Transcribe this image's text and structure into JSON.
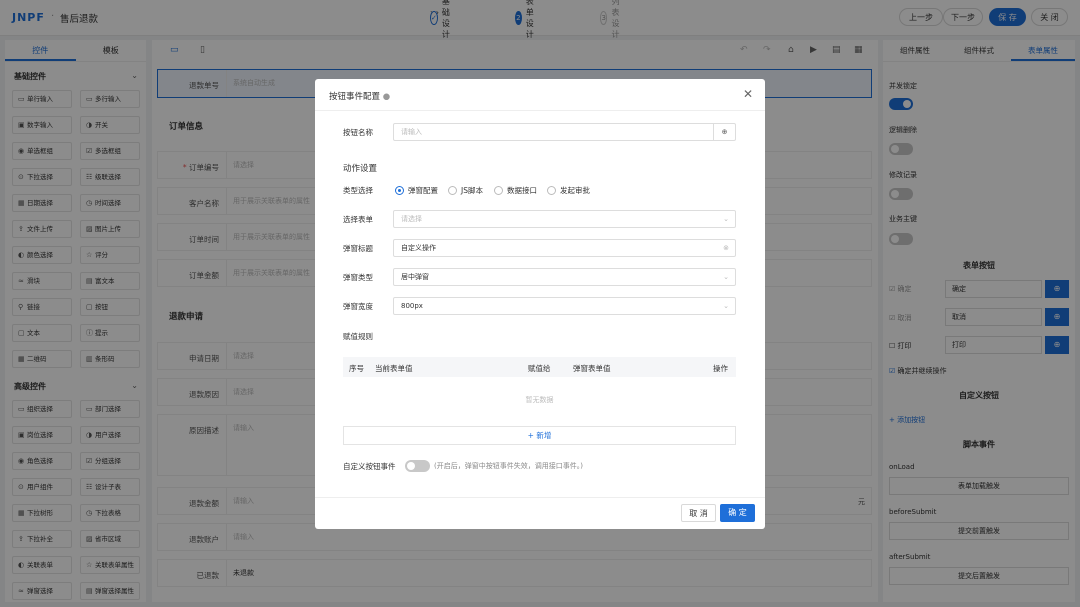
{
  "header": {
    "logo": "JNPF",
    "title": "售后退款",
    "steps": [
      {
        "num": "✓",
        "label": "基础设计"
      },
      {
        "num": "2",
        "label": "表单设计"
      },
      {
        "num": "3",
        "label": "列表设计"
      }
    ],
    "prev": "上一步",
    "next": "下一步",
    "save": "保 存",
    "close": "关 闭"
  },
  "left": {
    "tabs": [
      "控件",
      "模板"
    ],
    "basic_title": "基础控件",
    "adv_title": "高级控件",
    "basic": [
      [
        "单行输入",
        "多行输入"
      ],
      [
        "数字输入",
        "开关"
      ],
      [
        "单选框组",
        "多选框组"
      ],
      [
        "下拉选择",
        "级联选择"
      ],
      [
        "日期选择",
        "时间选择"
      ],
      [
        "文件上传",
        "图片上传"
      ],
      [
        "颜色选择",
        "评分"
      ],
      [
        "滑块",
        "富文本"
      ],
      [
        "链接",
        "按钮"
      ],
      [
        "文本",
        "提示"
      ],
      [
        "二维码",
        "条形码"
      ]
    ],
    "advanced": [
      [
        "组织选择",
        "部门选择"
      ],
      [
        "岗位选择",
        "用户选择"
      ],
      [
        "角色选择",
        "分组选择"
      ],
      [
        "用户组件",
        "设计子表"
      ],
      [
        "下拉树形",
        "下拉表格"
      ],
      [
        "下拉补全",
        "省市区域"
      ],
      [
        "关联表单",
        "关联表单属性"
      ],
      [
        "弹窗选择",
        "弹窗选择属性"
      ]
    ]
  },
  "canvas": {
    "refund_no": {
      "label": "退款单号",
      "placeholder": "系统自动生成"
    },
    "order_info": "订单信息",
    "order_no": {
      "label": "订单编号",
      "placeholder": "请选择"
    },
    "customer": {
      "label": "客户名称",
      "placeholder": "用于展示关联表单的属性"
    },
    "order_time": {
      "label": "订单时间",
      "placeholder": "用于展示关联表单的属性"
    },
    "order_amount": {
      "label": "订单金额",
      "placeholder": "用于展示关联表单的属性"
    },
    "refund_apply": "退款申请",
    "apply_date": {
      "label": "申请日期",
      "placeholder": "请选择"
    },
    "reason": {
      "label": "退款原因",
      "placeholder": "请选择"
    },
    "reason_desc": {
      "label": "原因描述",
      "placeholder": "请输入"
    },
    "refund_amount": {
      "label": "退款金额",
      "placeholder": "请输入",
      "suffix": "元"
    },
    "refund_account": {
      "label": "退款账户",
      "placeholder": "请输入"
    },
    "refunded": {
      "label": "已退款",
      "value": "未退款"
    }
  },
  "right": {
    "tabs": [
      "组件属性",
      "组件样式",
      "表单属性"
    ],
    "concurrency": "并发锁定",
    "logic_delete": "逻辑删除",
    "modify_log": "修改记录",
    "biz_key": "业务主键",
    "form_buttons": "表单按钮",
    "btn_rows": [
      {
        "check": "确定",
        "value": "确定"
      },
      {
        "check": "取消",
        "value": "取消"
      },
      {
        "check": "打印",
        "value": "打印"
      }
    ],
    "continue": "确定并继续操作",
    "custom_buttons": "自定义按钮",
    "add_button": "+ 添加按钮",
    "script_events": "脚本事件",
    "events": [
      {
        "name": "onLoad",
        "btn": "表单加载触发"
      },
      {
        "name": "beforeSubmit",
        "btn": "提交前置触发"
      },
      {
        "name": "afterSubmit",
        "btn": "提交后置触发"
      }
    ]
  },
  "modal": {
    "title": "按钮事件配置",
    "name_label": "按钮名称",
    "name_placeholder": "请输入",
    "action_title": "动作设置",
    "type_label": "类型选择",
    "types": [
      "弹窗配置",
      "JS脚本",
      "数据接口",
      "发起审批"
    ],
    "form_label": "选择表单",
    "form_placeholder": "请选择",
    "popup_title_label": "弹窗标题",
    "popup_title_value": "自定义操作",
    "popup_type_label": "弹窗类型",
    "popup_type_value": "居中弹窗",
    "popup_width_label": "弹窗宽度",
    "popup_width_value": "800px",
    "assign_label": "赋值规则",
    "table_cols": [
      "序号",
      "当前表单值",
      "赋值给",
      "弹窗表单值",
      "操作"
    ],
    "empty": "暂无数据",
    "add": "+ 新增",
    "custom_event_label": "自定义按钮事件",
    "custom_event_hint": "(开启后，弹窗中按钮事件失效，调用接口事件。)",
    "cancel": "取 消",
    "confirm": "确 定"
  },
  "colors": {
    "accent": "#1e6fd9"
  }
}
